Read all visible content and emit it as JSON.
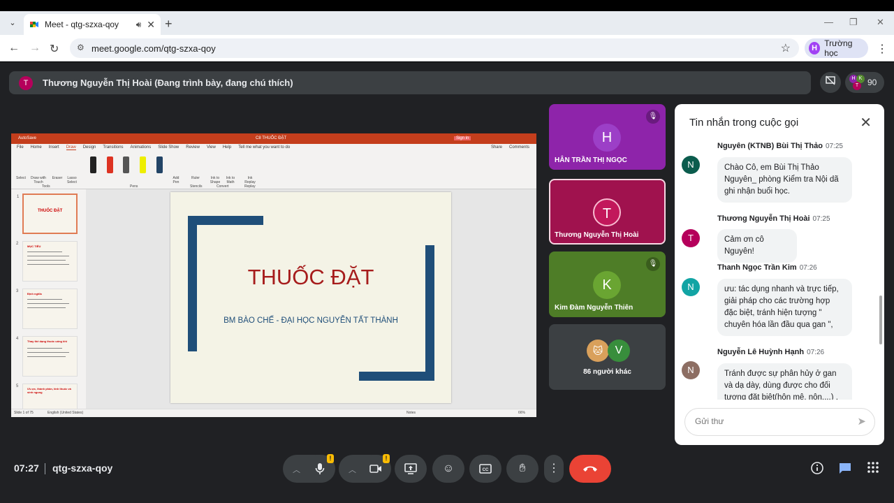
{
  "browser": {
    "tab_title": "Meet - qtg-szxa-qoy",
    "url": "meet.google.com/qtg-szxa-qoy",
    "profile_initial": "H",
    "profile_name": "Trường học"
  },
  "presenter": {
    "initial": "T",
    "text": "Thương Nguyễn Thị Hoài (Đang trình bày, đang chú thích)"
  },
  "participants_count": "90",
  "slide": {
    "title": "THUỐC ĐẶT",
    "subtitle": "BM BÀO CHẾ - ĐẠI HỌC NGUYỄN TẤT THÀNH",
    "pp_filename": "C8 THUỐC ĐẶT",
    "autosave": "AutoSave",
    "signin": "Sign in",
    "menu": [
      "File",
      "Home",
      "Insert",
      "Draw",
      "Design",
      "Transitions",
      "Animations",
      "Slide Show",
      "Review",
      "View",
      "Help",
      "Tell me what you want to do"
    ],
    "share_btn": "Share",
    "comments_btn": "Comments",
    "ribbon_groups": [
      "Select",
      "Draw with Touch",
      "Eraser",
      "Lasso Select",
      "Add Pen",
      "Ruler",
      "Ink to Shape",
      "Ink to Math",
      "Ink Replay"
    ],
    "group_labels": [
      "Tools",
      "Pens",
      "Stencils",
      "Convert",
      "Replay"
    ],
    "thumb_numbers": [
      "1",
      "2",
      "3",
      "4",
      "5"
    ],
    "thumb_titles": [
      "THUỐC ĐẶT",
      "MỤC TIÊU",
      "Định nghĩa",
      "Thay thế dạng thuốc uống khi",
      "Ưu ực, thành phần, tính thuốc và sinh ngung"
    ],
    "status_left": "Slide 1 of 75",
    "status_lang": "English (United States)",
    "status_notes": "Notes",
    "zoom": "66%"
  },
  "tiles": [
    {
      "initial": "H",
      "name": "HÂN TRẦN THỊ NGỌC",
      "muted": true
    },
    {
      "initial": "T",
      "name": "Thương Nguyễn Thị Hoài",
      "muted": false
    },
    {
      "initial": "K",
      "name": "Kim Đàm Nguyễn Thiên",
      "muted": true
    },
    {
      "initial": "V",
      "name": "86 người khác",
      "muted": false
    }
  ],
  "chat": {
    "header": "Tin nhắn trong cuộc gọi",
    "messages": [
      {
        "initial": "N",
        "sender": "Nguyên (KTNB) Bùi Thị Thảo",
        "time": "07:25",
        "text": "Chào Cô, em Bùi Thị Thảo Nguyên_ phòng Kiểm tra Nội dã ghi nhận buổi học.",
        "color": "#0b5c4d"
      },
      {
        "initial": "T",
        "sender": "Thương Nguyễn Thị Hoài",
        "time": "07:25",
        "text": "Cảm ơn cô Nguyên!",
        "color": "#b5005b"
      },
      {
        "initial": "N",
        "sender": "Thanh Ngọc Trần Kim",
        "time": "07:26",
        "text": "ưu: tác dụng nhanh và trực tiếp, giải pháp cho các trường hợp đặc biệt, tránh hiện tượng \" chuyên hóa lần đầu qua gan \",",
        "color": "#12a4a4"
      },
      {
        "initial": "N",
        "sender": "Nguyễn Lê Huỳnh Hạnh",
        "time": "07:26",
        "text": "Tránh được sự phân hủy ở gan và dạ dày, dùng được cho đối tượng đặt biệt(hôn mê, nôn,...) , tác dụng",
        "color": "#8d6e63"
      }
    ],
    "input_placeholder": "Gửi thư"
  },
  "bottom": {
    "time": "07:27",
    "meeting_code": "qtg-szxa-qoy"
  },
  "colors": {
    "meet_bg": "#202124",
    "tile_h": "#8e24aa",
    "tile_t": "#ad1457",
    "tile_k": "#558b2f",
    "end_call": "#ea4335"
  }
}
